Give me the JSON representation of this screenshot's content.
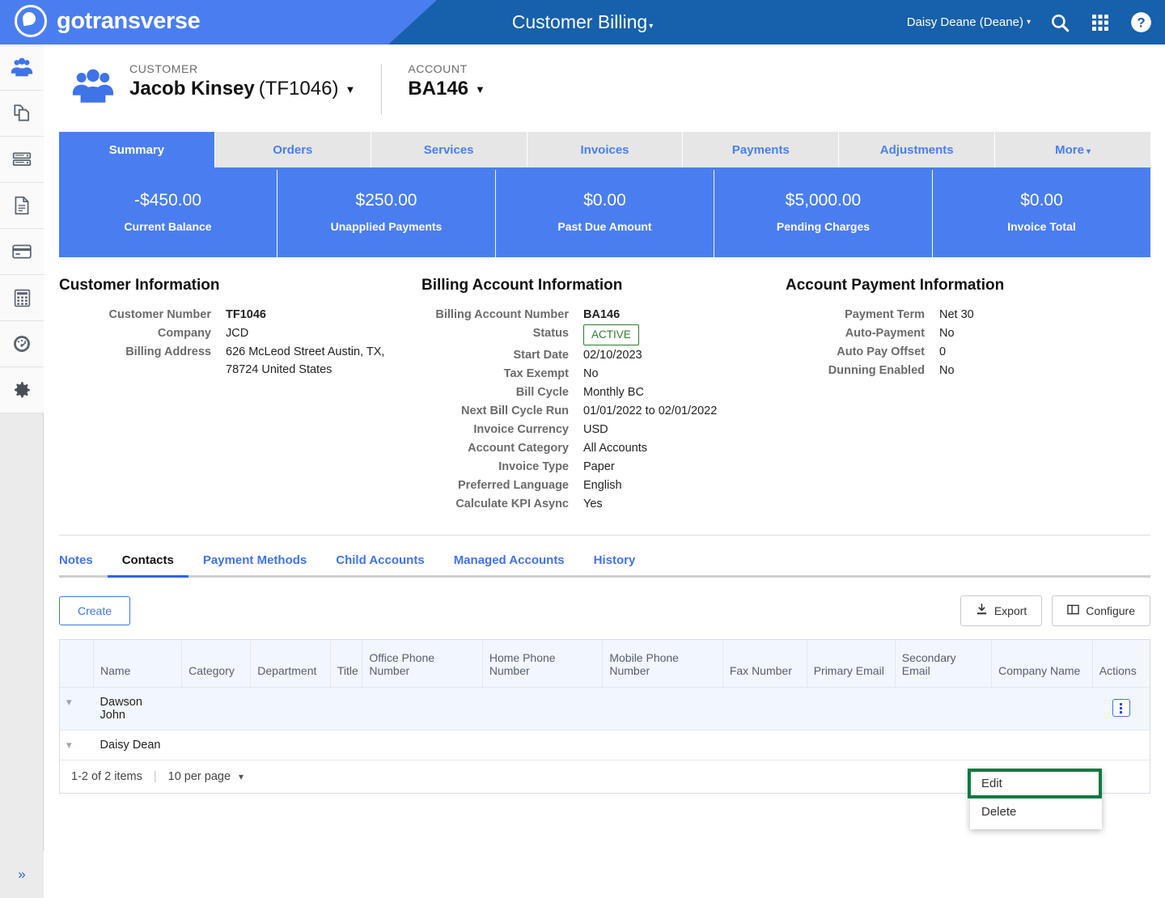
{
  "brand": {
    "name": "gotransverse",
    "logo_icon": "circle-swoosh-logo"
  },
  "topbar": {
    "app_title": "Customer Billing",
    "app_title_caret": "▾",
    "user": "Daisy Deane (Deane)",
    "user_caret": "▾",
    "icons": [
      "search-icon",
      "apps-grid-icon",
      "help-icon"
    ],
    "bg_dark": "#1760ac",
    "bg_light": "#4a7ef0"
  },
  "sidebar": {
    "items": [
      {
        "icon": "users-icon",
        "active": true
      },
      {
        "icon": "copy-documents-icon",
        "active": false
      },
      {
        "icon": "server-stack-icon",
        "active": false
      },
      {
        "icon": "document-icon",
        "active": false
      },
      {
        "icon": "credit-card-icon",
        "active": false
      },
      {
        "icon": "calculator-icon",
        "active": false
      },
      {
        "icon": "speedometer-icon",
        "active": false
      },
      {
        "icon": "gear-icon",
        "active": false
      }
    ],
    "collapse_label": "»"
  },
  "context": {
    "customer_label": "CUSTOMER",
    "customer_name": "Jacob Kinsey",
    "customer_number_paren": "(TF1046)",
    "account_label": "ACCOUNT",
    "account_value": "BA146",
    "caret": "▼"
  },
  "tabs": [
    {
      "label": "Summary",
      "active": true
    },
    {
      "label": "Orders",
      "active": false
    },
    {
      "label": "Services",
      "active": false
    },
    {
      "label": "Invoices",
      "active": false
    },
    {
      "label": "Payments",
      "active": false
    },
    {
      "label": "Adjustments",
      "active": false
    },
    {
      "label": "More",
      "active": false,
      "caret": "▾"
    }
  ],
  "kpis": [
    {
      "value": "-$450.00",
      "label": "Current Balance"
    },
    {
      "value": "$250.00",
      "label": "Unapplied Payments"
    },
    {
      "value": "$0.00",
      "label": "Past Due Amount"
    },
    {
      "value": "$5,000.00",
      "label": "Pending Charges"
    },
    {
      "value": "$0.00",
      "label": "Invoice Total"
    }
  ],
  "customer_information": {
    "heading": "Customer Information",
    "rows": [
      {
        "key": "Customer Number",
        "value": "TF1046",
        "bold": true
      },
      {
        "key": "Company",
        "value": "JCD"
      },
      {
        "key": "Billing Address",
        "value": "626 McLeod Street Austin, TX, 78724 United States"
      }
    ]
  },
  "billing_account_information": {
    "heading": "Billing Account Information",
    "rows": [
      {
        "key": "Billing Account Number",
        "value": "BA146",
        "bold": true
      },
      {
        "key": "Status",
        "value": "ACTIVE",
        "badge": true
      },
      {
        "key": "Start Date",
        "value": "02/10/2023"
      },
      {
        "key": "Tax Exempt",
        "value": "No"
      },
      {
        "key": "Bill Cycle",
        "value": "Monthly BC"
      },
      {
        "key": "Next Bill Cycle Run",
        "value": "01/01/2022 to 02/01/2022"
      },
      {
        "key": "Invoice Currency",
        "value": "USD"
      },
      {
        "key": "Account Category",
        "value": "All Accounts"
      },
      {
        "key": "Invoice Type",
        "value": "Paper"
      },
      {
        "key": "Preferred Language",
        "value": "English"
      },
      {
        "key": "Calculate KPI Async",
        "value": "Yes"
      }
    ],
    "status_badge_color": "#2e7d32"
  },
  "account_payment_information": {
    "heading": "Account Payment Information",
    "rows": [
      {
        "key": "Payment Term",
        "value": "Net 30"
      },
      {
        "key": "Auto-Payment",
        "value": "No"
      },
      {
        "key": "Auto Pay Offset",
        "value": "0"
      },
      {
        "key": "Dunning Enabled",
        "value": "No"
      }
    ]
  },
  "subtabs": [
    {
      "label": "Notes",
      "active": false
    },
    {
      "label": "Contacts",
      "active": true
    },
    {
      "label": "Payment Methods",
      "active": false
    },
    {
      "label": "Child Accounts",
      "active": false
    },
    {
      "label": "Managed Accounts",
      "active": false
    },
    {
      "label": "History",
      "active": false
    }
  ],
  "toolbar": {
    "create_label": "Create",
    "export_label": "Export",
    "configure_label": "Configure",
    "export_icon": "download-icon",
    "configure_icon": "columns-icon"
  },
  "table": {
    "columns": [
      "",
      "Name",
      "Category",
      "Department",
      "Title",
      "Office Phone Number",
      "Home Phone Number",
      "Mobile Phone Number",
      "Fax Number",
      "Primary Email",
      "Secondary Email",
      "Company Name",
      "Actions"
    ],
    "rows": [
      {
        "expand_icon": "chevron-down-icon",
        "name": "Dawson John",
        "category": "",
        "department": "",
        "title": "",
        "office_phone": "",
        "home_phone": "",
        "mobile_phone": "",
        "fax": "",
        "primary_email": "",
        "secondary_email": "",
        "company": "",
        "has_actions": true
      },
      {
        "expand_icon": "chevron-down-icon",
        "name": "Daisy Dean",
        "category": "",
        "department": "",
        "title": "",
        "office_phone": "",
        "home_phone": "",
        "mobile_phone": "",
        "fax": "",
        "primary_email": "",
        "secondary_email": "",
        "company": "",
        "has_actions": false
      }
    ],
    "footer": {
      "count_text": "1-2 of 2 items",
      "page_size": "10 per page",
      "page_size_caret": "▾"
    }
  },
  "context_menu": {
    "items": [
      {
        "label": "Edit",
        "highlighted": true
      },
      {
        "label": "Delete",
        "highlighted": false
      }
    ],
    "highlight_color": "#0d7a3f"
  }
}
